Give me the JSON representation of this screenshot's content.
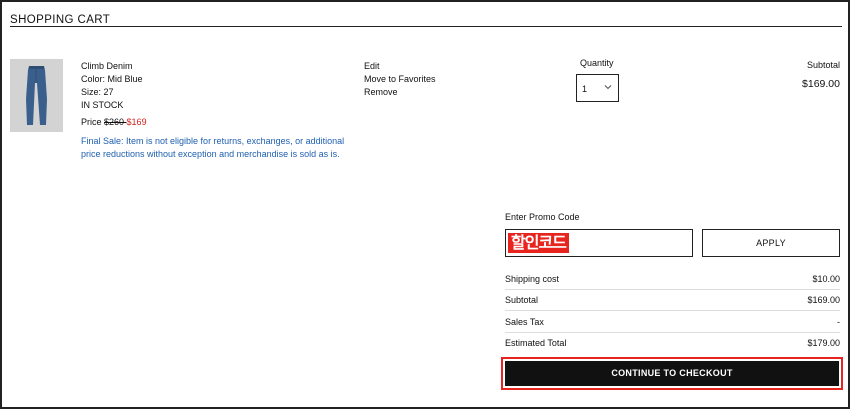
{
  "page": {
    "title": "SHOPPING CART"
  },
  "item": {
    "name": "Climb Denim",
    "color": "Color: Mid Blue",
    "size": "Size: 27",
    "stock": "IN STOCK",
    "price_label": "Price ",
    "price_old": "$260 ",
    "price_new": "$169",
    "final_sale": "Final Sale: Item is not eligible for returns, exchanges, or additional price reductions without exception and merchandise is sold as is.",
    "image_icon": "jeans-thumbnail"
  },
  "actions": {
    "edit": "Edit",
    "favorite": "Move to Favorites",
    "remove": "Remove"
  },
  "quantity": {
    "label": "Quantity",
    "value": "1",
    "icon": "chevron-down-icon"
  },
  "subtotal_col": {
    "label": "Subtotal",
    "value": "$169.00"
  },
  "promo": {
    "label": "Enter Promo Code",
    "stamp_text": "할인코드",
    "apply_label": "APPLY"
  },
  "summary": {
    "shipping_label": "Shipping cost",
    "shipping_value": "$10.00",
    "subtotal_label": "Subtotal",
    "subtotal_value": "$169.00",
    "tax_label": "Sales Tax",
    "tax_value": "-",
    "total_label": "Estimated Total",
    "total_value": "$179.00"
  },
  "checkout": {
    "label": "CONTINUE TO CHECKOUT"
  },
  "colors": {
    "sale_price": "#d32020",
    "final_sale_text": "#2060b0",
    "highlight_outline": "#e8241e",
    "checkout_bg": "#111111"
  }
}
